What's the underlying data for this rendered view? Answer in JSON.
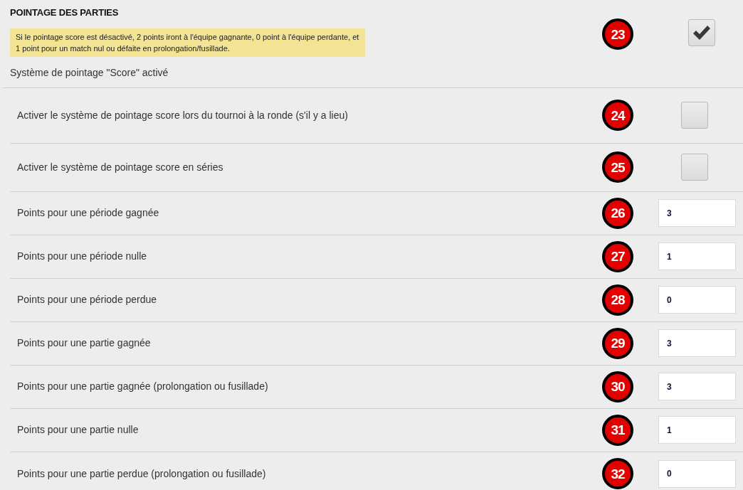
{
  "section": {
    "title": "POINTAGE DES PARTIES",
    "note": "Si le pointage score est désactivé, 2 points iront à l'équipe gagnante, 0 point à l'équipe perdante, et 1 point pour un match nul ou défaite en prolongation/fusillade.",
    "status": "Système de pointage \"Score\" activé",
    "marker": "23",
    "checked": true
  },
  "settings": [
    {
      "kind": "checkbox",
      "label": "Activer le système de pointage score lors du tournoi à la ronde (s'il y a lieu)",
      "marker": "24",
      "checked": false
    },
    {
      "kind": "checkbox",
      "label": "Activer le système de pointage score en séries",
      "marker": "25",
      "checked": false
    },
    {
      "kind": "number",
      "label": "Points pour une période gagnée",
      "marker": "26",
      "value": "3"
    },
    {
      "kind": "number",
      "label": "Points pour une période nulle",
      "marker": "27",
      "value": "1"
    },
    {
      "kind": "number",
      "label": "Points pour une période perdue",
      "marker": "28",
      "value": "0"
    },
    {
      "kind": "number",
      "label": "Points pour une partie gagnée",
      "marker": "29",
      "value": "3"
    },
    {
      "kind": "number",
      "label": "Points pour une partie gagnée (prolongation ou fusillade)",
      "marker": "30",
      "value": "3"
    },
    {
      "kind": "number",
      "label": "Points pour une partie nulle",
      "marker": "31",
      "value": "1"
    },
    {
      "kind": "number",
      "label": "Points pour une partie perdue (prolongation ou fusillade)",
      "marker": "32",
      "value": "0"
    }
  ]
}
